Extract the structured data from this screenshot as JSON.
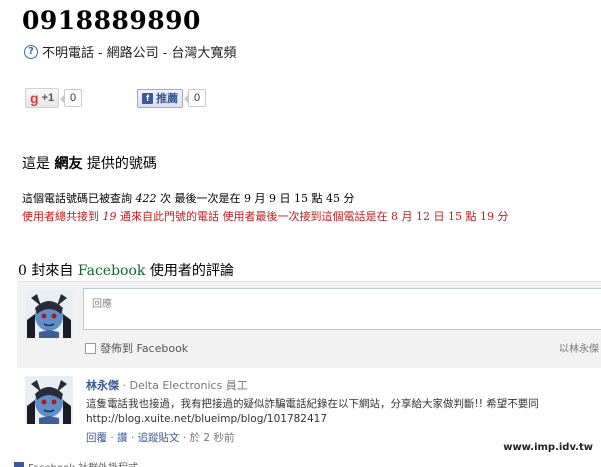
{
  "header": {
    "phone_number": "0918889890",
    "subtitle": "不明電話 - 網路公司 - 台灣大寬頻"
  },
  "share": {
    "gplus_g": "g",
    "gplus_label": "+1",
    "gplus_count": "0",
    "fb_label": "推薦",
    "fb_count": "0"
  },
  "provider": {
    "prefix": "這是",
    "source": "網友",
    "suffix": "提供的號碼"
  },
  "stats": {
    "line1_a": "這個電話號碼已被查詢 ",
    "query_count": "422",
    "line1_b": " 次 最後一次是在 9 月 9 日 15 點 45 分",
    "line2_a": "使用者總共接到 ",
    "received_count": "19",
    "line2_b": " 通來自此門號的電話 使用者最後一次接到這個電話是在 8 月 12 日 15 點 19 分"
  },
  "facebook_section": {
    "count": "0",
    "text_a": " 封來自 ",
    "fb_word": "Facebook",
    "text_b": " 使用者的評論"
  },
  "compose": {
    "placeholder": "回應",
    "post_to_label": "發佈到 Facebook",
    "post_as": "以林永傑"
  },
  "comments": [
    {
      "author": "林永傑",
      "org": "Delta Electronics 員工",
      "text_line1": "這隻電話我也接過，我有把接過的疑似詐騙電話紀錄在以下網站，分享給大家做判斷!! 希望不要同",
      "text_line2": "http://blog.xuite.net/blueimp/blog/101782417",
      "reply": "回覆",
      "like": "讚",
      "follow": "追蹤貼文",
      "time": "於 2 秒前"
    }
  ],
  "footer": {
    "watermark": "www.imp.idv.tw",
    "plugin": "Facebook 社群外掛程式"
  },
  "colors": {
    "fb_blue": "#3b5998",
    "stats_red": "#c21d1d",
    "fb_green": "#0f6a28"
  }
}
